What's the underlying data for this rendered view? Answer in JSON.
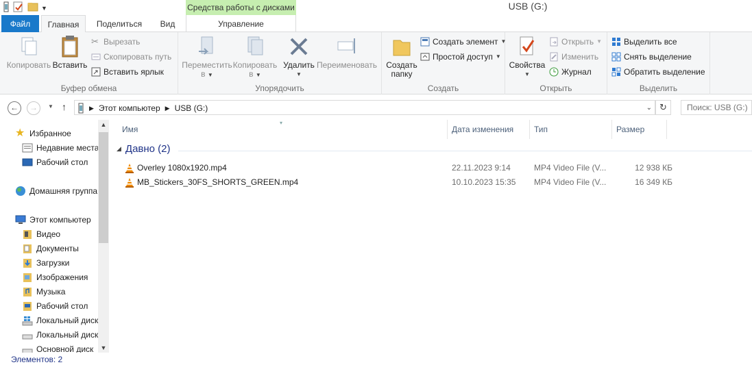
{
  "window": {
    "title": "USB (G:)",
    "context_tab_header": "Средства работы с дисками"
  },
  "tabs": {
    "file": "Файл",
    "home": "Главная",
    "share": "Поделиться",
    "view": "Вид",
    "manage": "Управление"
  },
  "ribbon": {
    "clipboard": {
      "label": "Буфер обмена",
      "copy": "Копировать",
      "paste": "Вставить",
      "cut": "Вырезать",
      "copy_path": "Скопировать путь",
      "paste_shortcut": "Вставить ярлык"
    },
    "organize": {
      "label": "Упорядочить",
      "move_to_1": "Переместить",
      "move_to_2": "в",
      "copy_to_1": "Копировать",
      "copy_to_2": "в",
      "delete": "Удалить",
      "rename": "Переименовать"
    },
    "new": {
      "label": "Создать",
      "new_folder_1": "Создать",
      "new_folder_2": "папку",
      "new_item": "Создать элемент",
      "easy_access": "Простой доступ"
    },
    "open": {
      "label": "Открыть",
      "properties": "Свойства",
      "open": "Открыть",
      "edit": "Изменить",
      "history": "Журнал"
    },
    "select": {
      "label": "Выделить",
      "select_all": "Выделить все",
      "select_none": "Снять выделение",
      "invert": "Обратить выделение"
    }
  },
  "address": {
    "path": [
      "Этот компьютер",
      "USB (G:)"
    ],
    "search_placeholder": "Поиск: USB (G:)"
  },
  "navpane": {
    "favorites": "Избранное",
    "recent": "Недавние места",
    "desktop_fav": "Рабочий стол",
    "homegroup": "Домашняя группа",
    "this_pc": "Этот компьютер",
    "videos": "Видео",
    "documents": "Документы",
    "downloads": "Загрузки",
    "pictures": "Изображения",
    "music": "Музыка",
    "desktop": "Рабочий стол",
    "local_disk_1": "Локальный диск",
    "local_disk_2": "Локальный диск",
    "main_disk": "Основной диск"
  },
  "filelist": {
    "columns": {
      "name": "Имя",
      "date": "Дата изменения",
      "type": "Тип",
      "size": "Размер"
    },
    "group": "Давно (2)",
    "files": [
      {
        "name": "Overley 1080x1920.mp4",
        "date": "22.11.2023 9:14",
        "type": "MP4 Video File (V...",
        "size": "12 938 КБ"
      },
      {
        "name": "MB_Stickers_30FS_SHORTS_GREEN.mp4",
        "date": "10.10.2023 15:35",
        "type": "MP4 Video File (V...",
        "size": "16 349 КБ"
      }
    ]
  },
  "status": {
    "items": "Элементов: 2"
  },
  "colors": {
    "file_tab": "#1979ca",
    "context_tab": "#c6eeb0",
    "group_header": "#1e3287"
  }
}
